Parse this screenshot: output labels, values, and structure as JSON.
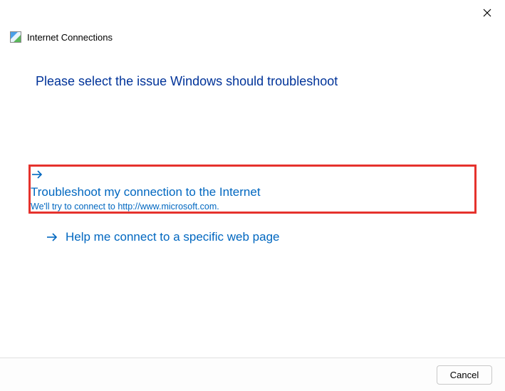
{
  "window": {
    "title": "Internet Connections"
  },
  "heading": "Please select the issue Windows should troubleshoot",
  "options": [
    {
      "title": "Troubleshoot my connection to the Internet",
      "subtitle": "We'll try to connect to http://www.microsoft.com."
    },
    {
      "title": "Help me connect to a specific web page"
    }
  ],
  "footer": {
    "cancel": "Cancel"
  }
}
